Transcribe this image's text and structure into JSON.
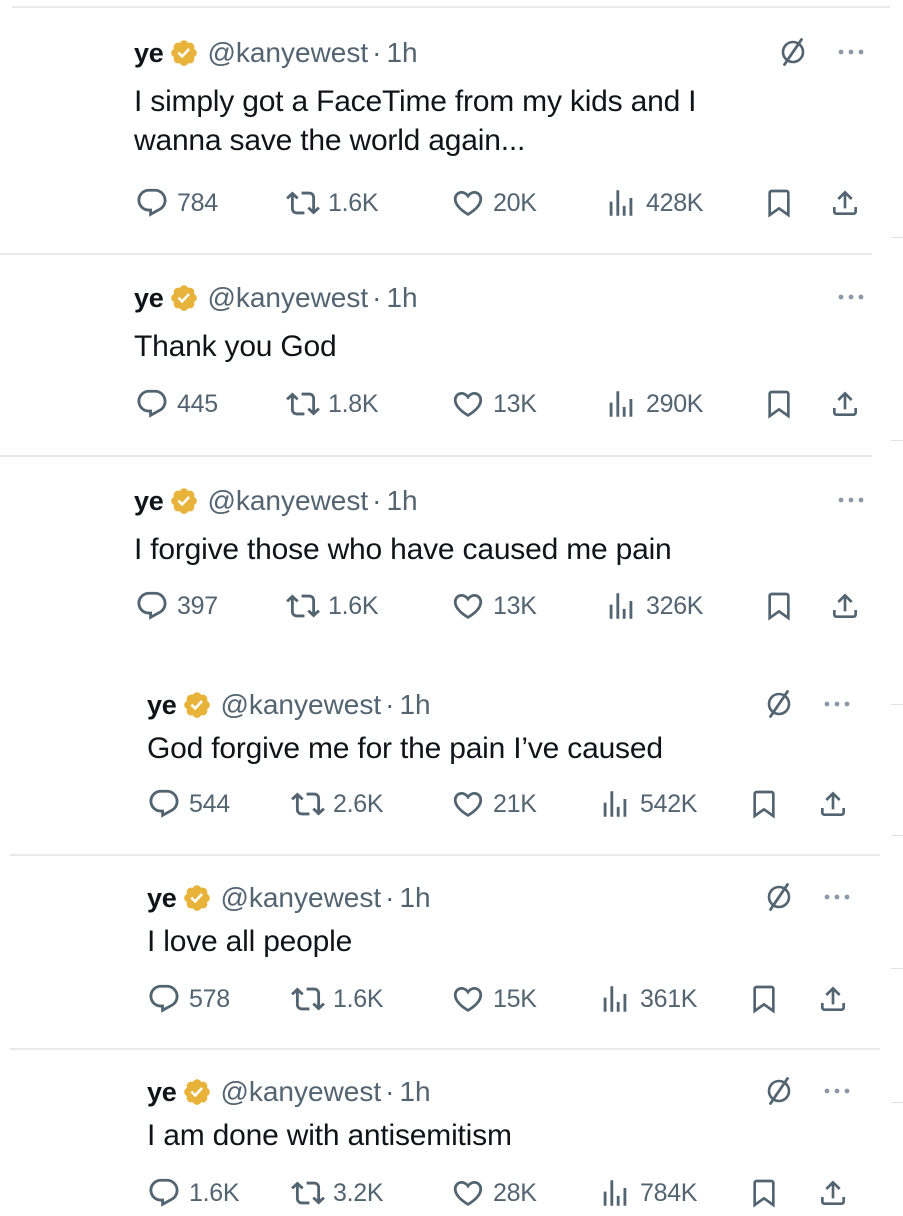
{
  "tweets": [
    {
      "name": "ye",
      "handle": "@kanyewest",
      "separator": "·",
      "time": "1h",
      "text": "I simply got a FaceTime from my kids and I\nwanna save the world again...",
      "replies": "784",
      "reposts": "1.6K",
      "likes": "20K",
      "views": "428K",
      "has_slash_icon": true
    },
    {
      "name": "ye",
      "handle": "@kanyewest",
      "separator": "·",
      "time": "1h",
      "text": "Thank you God",
      "replies": "445",
      "reposts": "1.8K",
      "likes": "13K",
      "views": "290K",
      "has_slash_icon": false
    },
    {
      "name": "ye",
      "handle": "@kanyewest",
      "separator": "·",
      "time": "1h",
      "text": "I forgive those who have caused me pain",
      "replies": "397",
      "reposts": "1.6K",
      "likes": "13K",
      "views": "326K",
      "has_slash_icon": false
    },
    {
      "name": "ye",
      "handle": "@kanyewest",
      "separator": "·",
      "time": "1h",
      "text": "God forgive me for the pain I’ve caused",
      "replies": "544",
      "reposts": "2.6K",
      "likes": "21K",
      "views": "542K",
      "has_slash_icon": true
    },
    {
      "name": "ye",
      "handle": "@kanyewest",
      "separator": "·",
      "time": "1h",
      "text": "I love all people",
      "replies": "578",
      "reposts": "1.6K",
      "likes": "15K",
      "views": "361K",
      "has_slash_icon": true
    },
    {
      "name": "ye",
      "handle": "@kanyewest",
      "separator": "·",
      "time": "1h",
      "text": "I am done with antisemitism",
      "replies": "1.6K",
      "reposts": "3.2K",
      "likes": "28K",
      "views": "784K",
      "has_slash_icon": true
    }
  ],
  "icons": {
    "verified_badge": "verified-badge-icon",
    "edit_indicator": "slash-circle-icon",
    "more": "more-icon",
    "reply": "reply-icon",
    "repost": "repost-icon",
    "like": "like-icon",
    "views": "views-icon",
    "bookmark": "bookmark-icon",
    "share": "share-icon"
  },
  "colors": {
    "badge": "#E8B33A",
    "text": "#0F1419",
    "secondary": "#536471",
    "divider": "#E7E9EC"
  }
}
